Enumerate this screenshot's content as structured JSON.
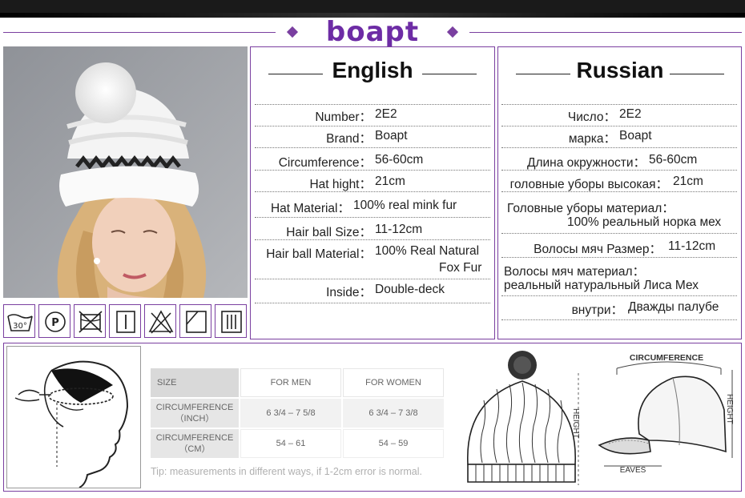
{
  "brand": {
    "logo_text": "boapt"
  },
  "english": {
    "title": "English",
    "rows": [
      {
        "label": "Number：",
        "value": "2E2"
      },
      {
        "label": "Brand：",
        "value": "Boapt"
      },
      {
        "label": "Circumference：",
        "value": "56-60cm"
      },
      {
        "label": "Hat hight：",
        "value": "21cm"
      },
      {
        "label": "Hat Material：",
        "value": "100% real mink fur"
      },
      {
        "label": "Hair ball Size：",
        "value": "11-12cm"
      },
      {
        "label": "Hair ball Material：",
        "value": "100% Real Natural",
        "value2": "Fox Fur"
      },
      {
        "label": "Inside：",
        "value": "Double-deck"
      }
    ]
  },
  "russian": {
    "title": "Russian",
    "rows": [
      {
        "label": "Число：",
        "value": "2E2"
      },
      {
        "label": "марка：",
        "value": "Boapt"
      },
      {
        "label": "Длина окружности：",
        "value": "56-60cm"
      },
      {
        "label": "головные уборы высокая：",
        "value": "21cm"
      },
      {
        "label": "Головные уборы материал：",
        "value": "100% реальный норка мех"
      },
      {
        "label": "Волосы мяч Размер：",
        "value": "11-12cm"
      },
      {
        "label": "Волосы мяч материал：",
        "value": "реальный натуральный Лиса Мех"
      },
      {
        "label": "внутри：",
        "value": "Дважды палубе"
      }
    ]
  },
  "care_icons": [
    "wash-30-icon",
    "dry-clean-p-icon",
    "no-tumble-dry-icon",
    "line-dry-icon",
    "no-bleach-icon",
    "dry-flat-icon",
    "drip-dry-icon"
  ],
  "care_text": {
    "wash_temp": "30°",
    "dry_clean": "P"
  },
  "size_table": {
    "headers": [
      "SIZE",
      "FOR MEN",
      "FOR WOMEN"
    ],
    "rows": [
      {
        "label": "CIRCUMFERENCE",
        "unit": "（INCH）",
        "men": "6 3/4 – 7 5/8",
        "women": "6 3/4 – 7 3/8"
      },
      {
        "label": "CIRCUMFERENCE",
        "unit": "（CM）",
        "men": "54 – 61",
        "women": "54 – 59"
      }
    ]
  },
  "tip": "Tip: measurements in different ways, if 1-2cm error is normal.",
  "diagram_labels": {
    "beanie_height": "HEIGHT",
    "cap_circumference": "CIRCUMFERENCE",
    "cap_height": "HEIGHT",
    "cap_eaves": "EAVES"
  },
  "colors": {
    "accent": "#7a3fa0",
    "logo": "#6d2ca5"
  }
}
